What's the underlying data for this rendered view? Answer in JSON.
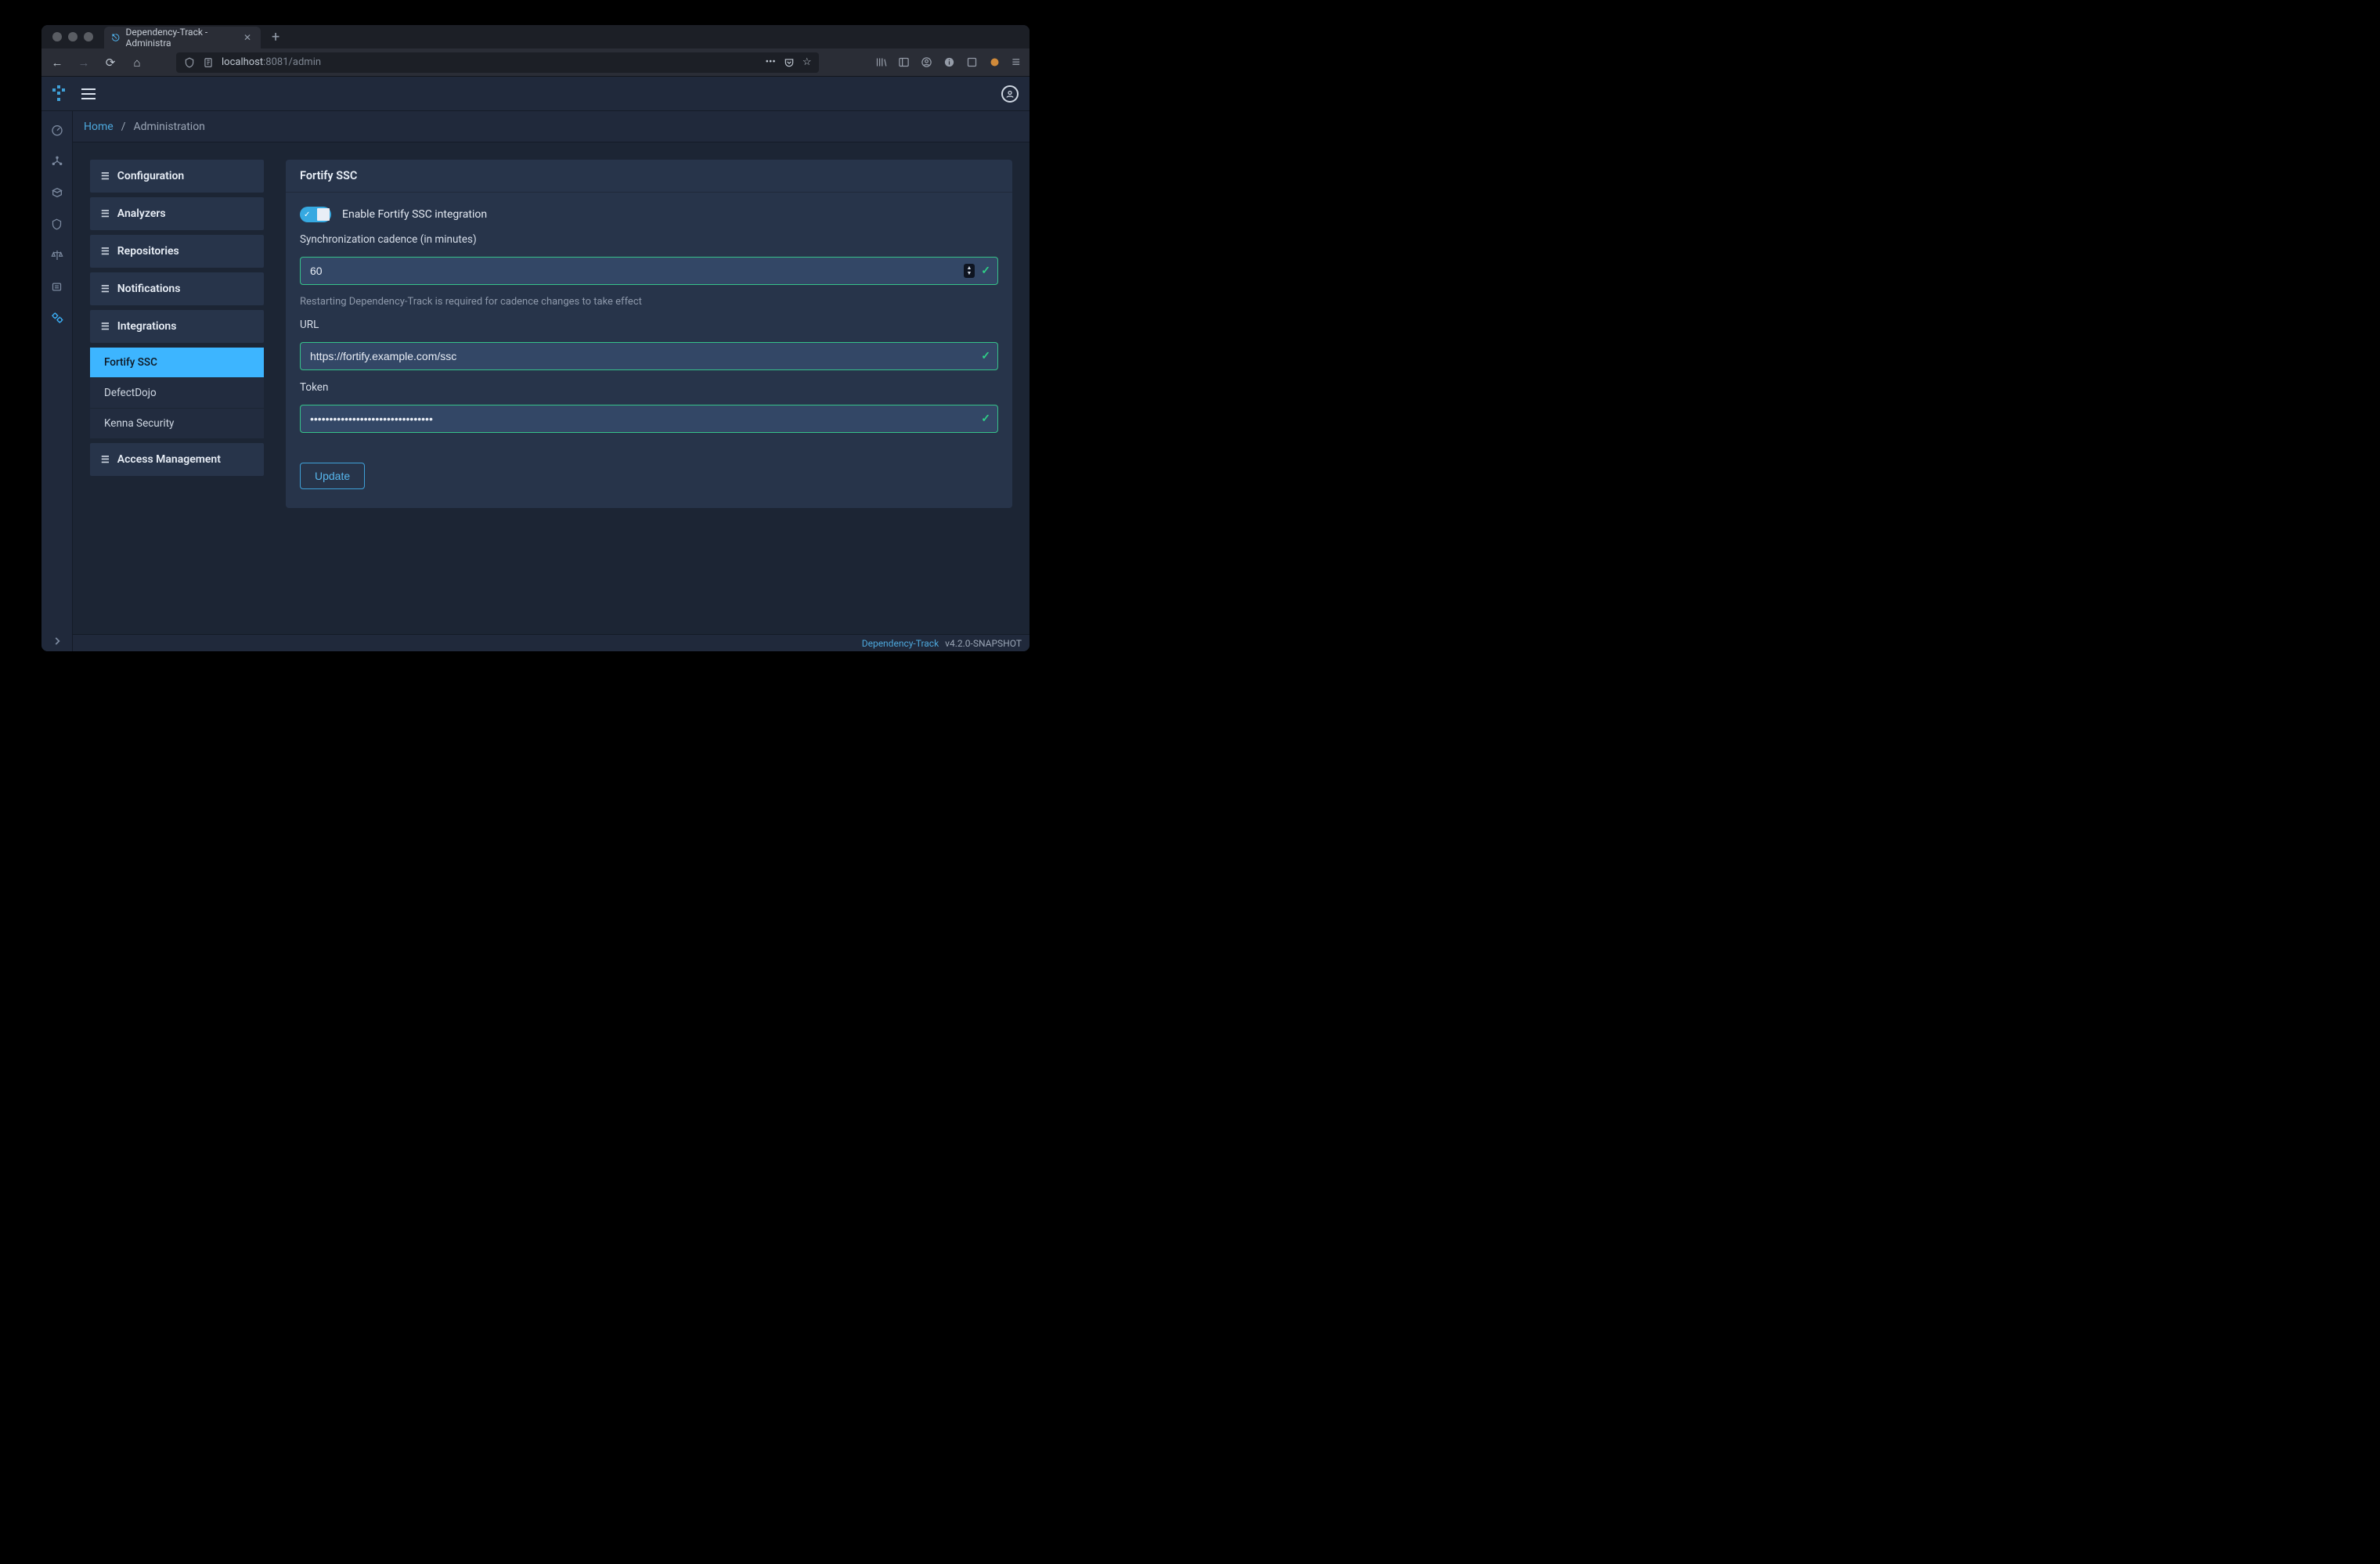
{
  "browser": {
    "tab_title": "Dependency-Track - Administra",
    "url_host": "localhost",
    "url_port": ":8081",
    "url_path": "/admin"
  },
  "breadcrumb": {
    "home": "Home",
    "sep": "/",
    "current": "Administration"
  },
  "adminnav": {
    "configuration": "Configuration",
    "analyzers": "Analyzers",
    "repositories": "Repositories",
    "notifications": "Notifications",
    "integrations": "Integrations",
    "access": "Access Management",
    "sub": {
      "fortify": "Fortify SSC",
      "defectdojo": "DefectDojo",
      "kenna": "Kenna Security"
    }
  },
  "panel": {
    "title": "Fortify SSC",
    "enable_label": "Enable Fortify SSC integration",
    "cadence_label": "Synchronization cadence (in minutes)",
    "cadence_value": "60",
    "cadence_help": "Restarting Dependency-Track is required for cadence changes to take effect",
    "url_label": "URL",
    "url_value": "https://fortify.example.com/ssc",
    "token_label": "Token",
    "token_value": "••••••••••••••••••••••••••••••••",
    "update": "Update"
  },
  "footer": {
    "product": "Dependency-Track",
    "version": "v4.2.0-SNAPSHOT"
  }
}
